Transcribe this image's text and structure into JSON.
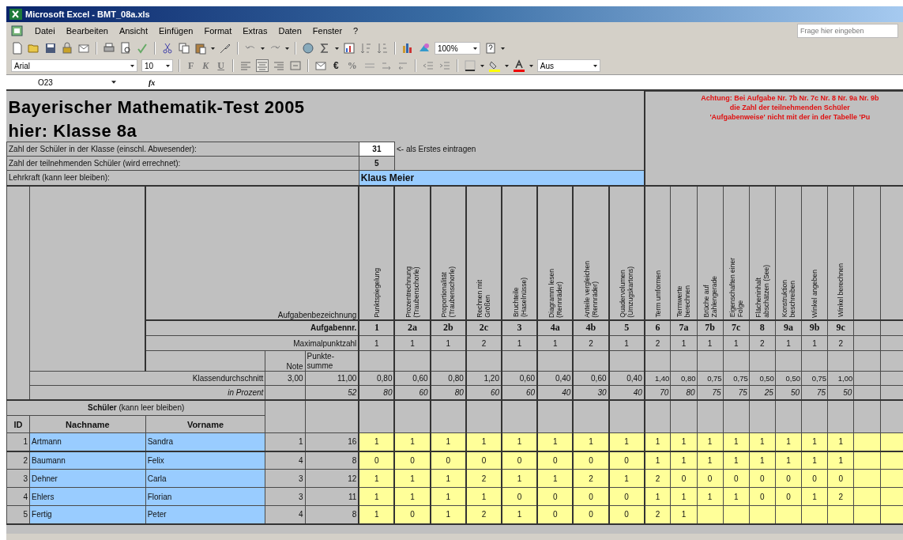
{
  "window": {
    "title": "Microsoft Excel - BMT_08a.xls"
  },
  "menu": [
    "Datei",
    "Bearbeiten",
    "Ansicht",
    "Einfügen",
    "Format",
    "Extras",
    "Daten",
    "Fenster",
    "?"
  ],
  "help_box": {
    "placeholder": "Frage hier eingeben"
  },
  "toolbar": {
    "zoom": "100%"
  },
  "format_toolbar": {
    "font": "Arial",
    "size": "10",
    "style_buttons": [
      "F",
      "K",
      "U"
    ],
    "currency": "€",
    "percent": "%",
    "style_box": "Aus"
  },
  "formula_bar": {
    "name_box": "O23",
    "fx": "fx"
  },
  "sheet": {
    "title": "Bayerischer Mathematik-Test 2005",
    "subtitle": "hier: Klasse 8a",
    "notice": [
      "Achtung: Bei Aufgabe Nr. 7b Nr. 7c Nr. 8 Nr. 9a Nr. 9b",
      "die Zahl der teilnehmenden Schüler",
      "'Aufgabenweise' nicht mit der in der Tabelle 'Pu"
    ],
    "class_size": {
      "label": "Zahl der Schüler in der Klasse (einschl. Abwesender):",
      "value": "31",
      "note": "<- als Erstes eintragen"
    },
    "participants": {
      "label": "Zahl der teilnehmenden Schüler (wird errechnet):",
      "value": "5"
    },
    "teacher": {
      "label": "Lehrkraft (kann leer bleiben):",
      "value": "Klaus Meier"
    },
    "row_labels": {
      "task_name": "Aufgabenbezeichnung",
      "task_number": "Aufgabennr.",
      "max_points": "Maximalpunktzahl",
      "grade": "Note",
      "points_sum": "Punkte-\nsumme",
      "average": "Klassendurchschnitt",
      "percent": "in Prozent"
    },
    "grade_average": "3,00",
    "points_average": "11,00",
    "points_percent": "52",
    "students_heading": "**Schüler** (kann leer bleiben)",
    "columns": {
      "id": "ID",
      "last_name": "Nachname",
      "first_name": "Vorname"
    },
    "tasks": [
      {
        "name": "Punktspiegelung",
        "number": "1",
        "max": "1",
        "average": "0,80",
        "percent": "80"
      },
      {
        "name": "Prozentrechnung\n(Traubenschorle)",
        "number": "2a",
        "max": "1",
        "average": "0,60",
        "percent": "60"
      },
      {
        "name": "Proportionalität\n(Traubenschorle)",
        "number": "2b",
        "max": "1",
        "average": "0,80",
        "percent": "80"
      },
      {
        "name": "Rechnen mit\nGrößen",
        "number": "2c",
        "max": "2",
        "average": "1,20",
        "percent": "60"
      },
      {
        "name": "Bruchteile\n(Haselnüsse)",
        "number": "3",
        "max": "1",
        "average": "0,60",
        "percent": "60"
      },
      {
        "name": "Diagramm lesen\n(Rennräder)",
        "number": "4a",
        "max": "1",
        "average": "0,40",
        "percent": "40"
      },
      {
        "name": "Anteile vergleichen\n(Rennräder)",
        "number": "4b",
        "max": "2",
        "average": "0,60",
        "percent": "30"
      },
      {
        "name": "Quadervolumen\n(Umzugskartons)",
        "number": "5",
        "max": "1",
        "average": "0,40",
        "percent": "40"
      },
      {
        "name": "Term umformen",
        "number": "6",
        "max": "2",
        "average": "1,40",
        "percent": "70"
      },
      {
        "name": "Termwerte\nberechnen",
        "number": "7a",
        "max": "1",
        "average": "0,80",
        "percent": "80"
      },
      {
        "name": "Brüche auf\nZahlengerade",
        "number": "7b",
        "max": "1",
        "average": "0,75",
        "percent": "75"
      },
      {
        "name": "Eigenschaften einer\nFolge",
        "number": "7c",
        "max": "1",
        "average": "0,75",
        "percent": "75"
      },
      {
        "name": "Flächeninhalt\nabschätzen (See)",
        "number": "8",
        "max": "2",
        "average": "0,50",
        "percent": "25"
      },
      {
        "name": "Konstruktion\nbeschreiben",
        "number": "9a",
        "max": "1",
        "average": "0,50",
        "percent": "50"
      },
      {
        "name": "Winkel angeben",
        "number": "9b",
        "max": "1",
        "average": "0,75",
        "percent": "75"
      },
      {
        "name": "Winkel berechnen",
        "number": "9c",
        "max": "2",
        "average": "1,00",
        "percent": "50"
      }
    ],
    "students": [
      {
        "id": "1",
        "last_name": "Artmann",
        "first_name": "Sandra",
        "grade": "1",
        "points": "16",
        "scores": [
          "1",
          "1",
          "1",
          "1",
          "1",
          "1",
          "1",
          "1",
          "1",
          "1",
          "1",
          "1",
          "1",
          "1",
          "1",
          "1"
        ]
      },
      {
        "id": "2",
        "last_name": "Baumann",
        "first_name": "Felix",
        "grade": "4",
        "points": "8",
        "scores": [
          "0",
          "0",
          "0",
          "0",
          "0",
          "0",
          "0",
          "0",
          "1",
          "1",
          "1",
          "1",
          "1",
          "1",
          "1",
          "1"
        ]
      },
      {
        "id": "3",
        "last_name": "Dehner",
        "first_name": "Carla",
        "grade": "3",
        "points": "12",
        "scores": [
          "1",
          "1",
          "1",
          "2",
          "1",
          "1",
          "2",
          "1",
          "2",
          "0",
          "0",
          "0",
          "0",
          "0",
          "0",
          "0"
        ]
      },
      {
        "id": "4",
        "last_name": "Ehlers",
        "first_name": "Florian",
        "grade": "3",
        "points": "11",
        "scores": [
          "1",
          "1",
          "1",
          "1",
          "0",
          "0",
          "0",
          "0",
          "1",
          "1",
          "1",
          "1",
          "0",
          "0",
          "1",
          "2"
        ]
      },
      {
        "id": "5",
        "last_name": "Fertig",
        "first_name": "Peter",
        "grade": "4",
        "points": "8",
        "scores": [
          "1",
          "0",
          "1",
          "2",
          "1",
          "0",
          "0",
          "0",
          "2",
          "1"
        ]
      }
    ]
  }
}
